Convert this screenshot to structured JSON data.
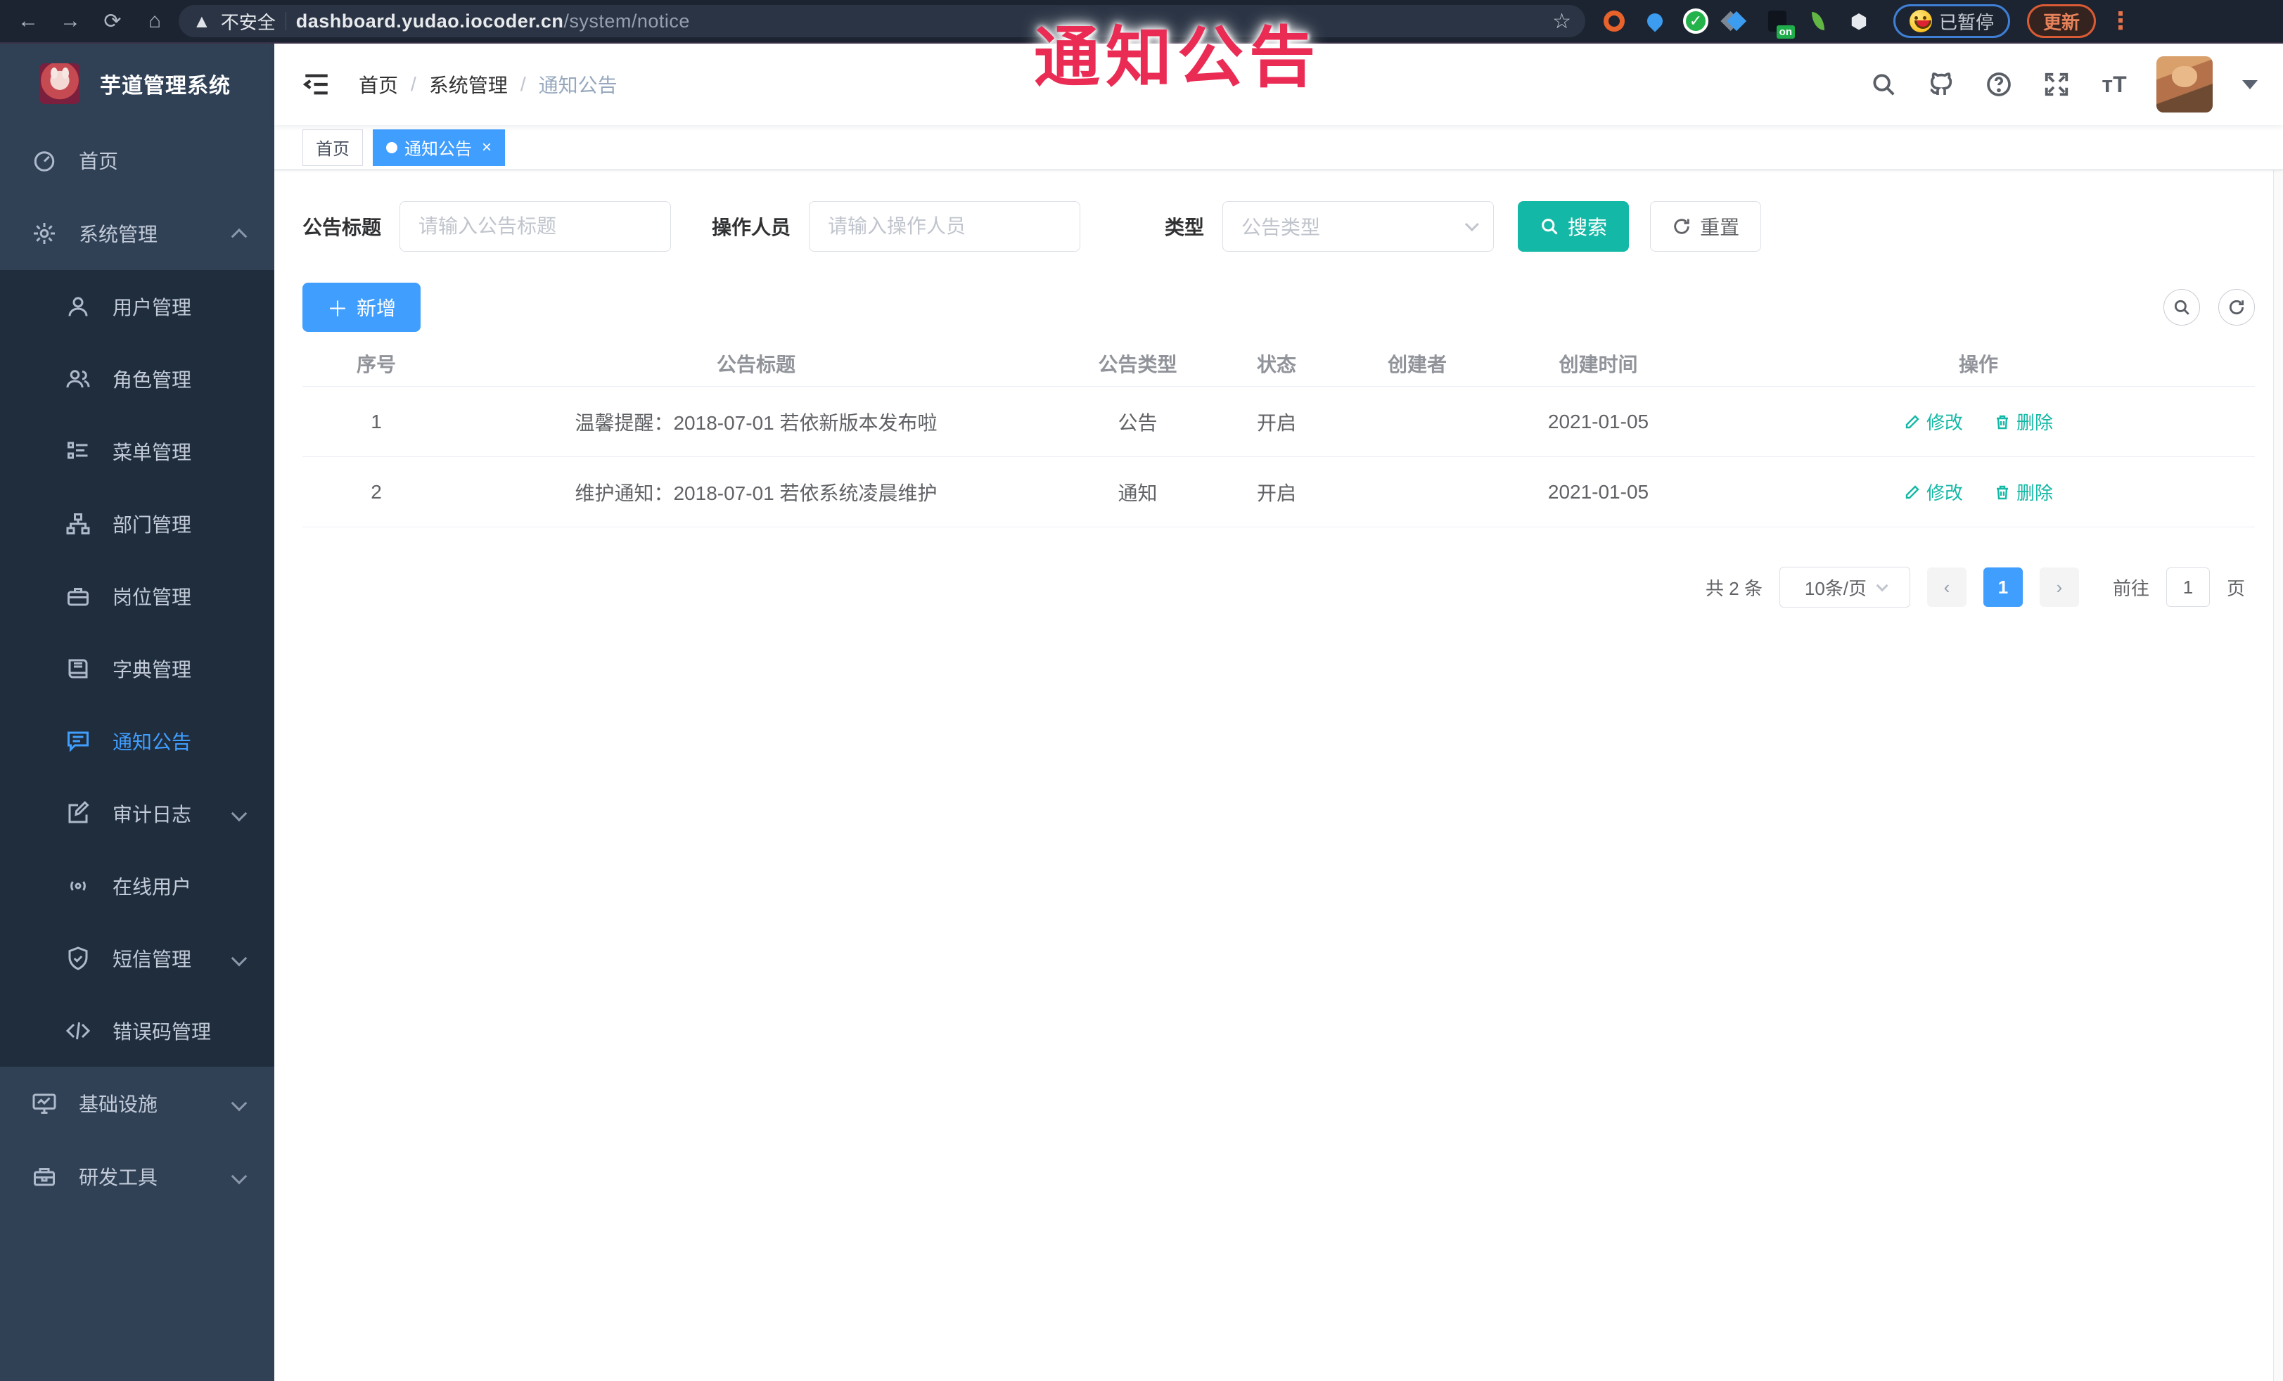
{
  "browser": {
    "security_label": "不安全",
    "url_domain": "dashboard.yudao.iocoder.cn",
    "url_path": "/system/notice",
    "paused_label": "已暂停",
    "update_label": "更新"
  },
  "annotation": {
    "text": "通知公告"
  },
  "sidebar": {
    "title": "芋道管理系统",
    "items": [
      {
        "label": "首页"
      },
      {
        "label": "系统管理",
        "expanded": true
      },
      {
        "label": "用户管理"
      },
      {
        "label": "角色管理"
      },
      {
        "label": "菜单管理"
      },
      {
        "label": "部门管理"
      },
      {
        "label": "岗位管理"
      },
      {
        "label": "字典管理"
      },
      {
        "label": "通知公告",
        "active": true
      },
      {
        "label": "审计日志"
      },
      {
        "label": "在线用户"
      },
      {
        "label": "短信管理"
      },
      {
        "label": "错误码管理"
      },
      {
        "label": "基础设施"
      },
      {
        "label": "研发工具"
      }
    ]
  },
  "navbar": {
    "breadcrumb": {
      "items": [
        "首页",
        "系统管理",
        "通知公告"
      ],
      "separator": "/"
    }
  },
  "tags": [
    {
      "label": "首页",
      "active": false
    },
    {
      "label": "通知公告",
      "active": true,
      "close": "×"
    }
  ],
  "filter": {
    "title_label": "公告标题",
    "title_placeholder": "请输入公告标题",
    "operator_label": "操作人员",
    "operator_placeholder": "请输入操作人员",
    "type_label": "类型",
    "type_placeholder": "公告类型",
    "search_label": "搜索",
    "reset_label": "重置"
  },
  "toolbar": {
    "add_label": "新增"
  },
  "table": {
    "headers": [
      "序号",
      "公告标题",
      "公告类型",
      "状态",
      "创建者",
      "创建时间",
      "操作"
    ],
    "actions": {
      "edit_label": "修改",
      "delete_label": "删除"
    },
    "rows": [
      {
        "no": "1",
        "title": "温馨提醒：2018-07-01 若依新版本发布啦",
        "type": "公告",
        "status": "开启",
        "creator": "",
        "created": "2021-01-05"
      },
      {
        "no": "2",
        "title": "维护通知：2018-07-01 若依系统凌晨维护",
        "type": "通知",
        "status": "开启",
        "creator": "",
        "created": "2021-01-05"
      }
    ]
  },
  "pagination": {
    "total": "共 2 条",
    "size": "10条/页",
    "prev": "‹",
    "page": "1",
    "next": "›",
    "goto_label": "前往",
    "goto_value": "1",
    "unit": "页"
  },
  "colors": {
    "primary": "#409EFF",
    "teal": "#14b8a6",
    "sidebar_bg": "#304156",
    "submenu_bg": "#1f2d3d",
    "annotation_red": "#ea2c55"
  }
}
